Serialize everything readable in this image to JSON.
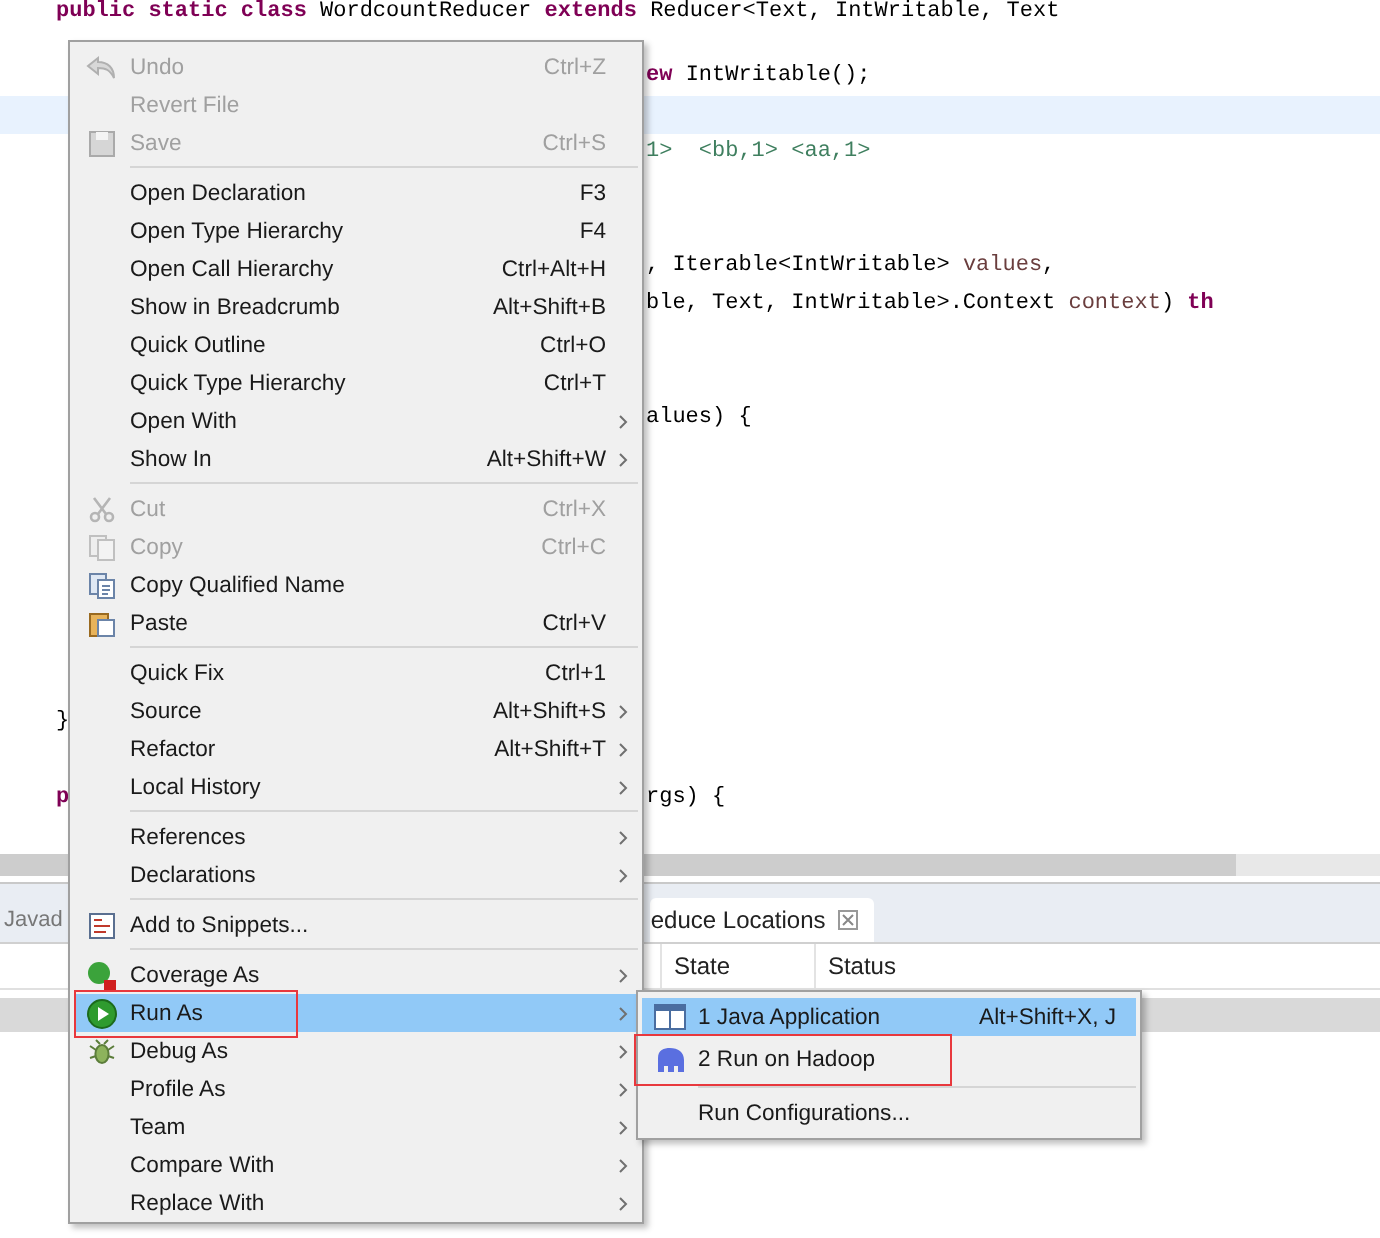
{
  "editor": {
    "lines": [
      {
        "left": [
          {
            "text": "public static class ",
            "kind": "keyword"
          },
          {
            "text": "WordcountReducer ",
            "kind": "plain"
          },
          {
            "text": "extends ",
            "kind": "keyword"
          },
          {
            "text": "Reducer<Text, IntWritable, Text",
            "kind": "plain"
          }
        ]
      },
      {
        "right": [
          {
            "text": "ew ",
            "kind": "keyword"
          },
          {
            "text": "IntWritable();",
            "kind": "plain"
          }
        ]
      },
      {
        "current": true
      },
      {
        "right": [
          {
            "text": "1>  <bb,1> <aa,1>",
            "kind": "comment"
          }
        ]
      },
      {
        "right": [
          {
            "text": ", Iterable<IntWritable> ",
            "kind": "plain"
          },
          {
            "text": "values",
            "kind": "param"
          },
          {
            "text": ",",
            "kind": "plain"
          }
        ]
      },
      {
        "right": [
          {
            "text": "ble, Text, IntWritable>.Context ",
            "kind": "plain"
          },
          {
            "text": "context",
            "kind": "param"
          },
          {
            "text": ") ",
            "kind": "plain"
          },
          {
            "text": "th",
            "kind": "keyword"
          }
        ]
      },
      {
        "right": [
          {
            "text": "alues) {",
            "kind": "plain"
          }
        ]
      },
      {
        "left": [
          {
            "text": "}",
            "kind": "plain"
          }
        ]
      },
      {
        "left": [
          {
            "text": "p",
            "kind": "keyword"
          }
        ],
        "right": [
          {
            "text": "rgs) {",
            "kind": "plain"
          }
        ]
      }
    ]
  },
  "bottom_panel": {
    "tabs": [
      {
        "label": "Javad",
        "selected": false,
        "closable": false
      },
      {
        "label": "educe Locations",
        "selected": true,
        "closable": true
      }
    ],
    "columns": [
      "State",
      "Status"
    ],
    "rows": [
      {
        "selected": true
      }
    ]
  },
  "context_menu": {
    "items": [
      {
        "kind": "item",
        "label": "Undo",
        "shortcut": "Ctrl+Z",
        "disabled": true,
        "submenu": false,
        "selected": false
      },
      {
        "kind": "item",
        "label": "Revert File",
        "disabled": true,
        "submenu": false,
        "selected": false
      },
      {
        "kind": "item",
        "label": "Save",
        "shortcut": "Ctrl+S",
        "disabled": true,
        "submenu": false,
        "selected": false
      },
      {
        "kind": "separator"
      },
      {
        "kind": "item",
        "label": "Open Declaration",
        "shortcut": "F3",
        "disabled": false,
        "submenu": false,
        "selected": false
      },
      {
        "kind": "item",
        "label": "Open Type Hierarchy",
        "shortcut": "F4",
        "disabled": false,
        "submenu": false,
        "selected": false
      },
      {
        "kind": "item",
        "label": "Open Call Hierarchy",
        "shortcut": "Ctrl+Alt+H",
        "disabled": false,
        "submenu": false,
        "selected": false
      },
      {
        "kind": "item",
        "label": "Show in Breadcrumb",
        "shortcut": "Alt+Shift+B",
        "disabled": false,
        "submenu": false,
        "selected": false
      },
      {
        "kind": "item",
        "label": "Quick Outline",
        "shortcut": "Ctrl+O",
        "disabled": false,
        "submenu": false,
        "selected": false
      },
      {
        "kind": "item",
        "label": "Quick Type Hierarchy",
        "shortcut": "Ctrl+T",
        "disabled": false,
        "submenu": false,
        "selected": false
      },
      {
        "kind": "item",
        "label": "Open With",
        "disabled": false,
        "submenu": true,
        "selected": false
      },
      {
        "kind": "item",
        "label": "Show In",
        "shortcut": "Alt+Shift+W",
        "disabled": false,
        "submenu": true,
        "selected": false
      },
      {
        "kind": "separator"
      },
      {
        "kind": "item",
        "label": "Cut",
        "shortcut": "Ctrl+X",
        "disabled": true,
        "submenu": false,
        "selected": false
      },
      {
        "kind": "item",
        "label": "Copy",
        "shortcut": "Ctrl+C",
        "disabled": true,
        "submenu": false,
        "selected": false
      },
      {
        "kind": "item",
        "label": "Copy Qualified Name",
        "disabled": false,
        "submenu": false,
        "selected": false
      },
      {
        "kind": "item",
        "label": "Paste",
        "shortcut": "Ctrl+V",
        "disabled": false,
        "submenu": false,
        "selected": false
      },
      {
        "kind": "separator"
      },
      {
        "kind": "item",
        "label": "Quick Fix",
        "shortcut": "Ctrl+1",
        "disabled": false,
        "submenu": false,
        "selected": false
      },
      {
        "kind": "item",
        "label": "Source",
        "shortcut": "Alt+Shift+S",
        "disabled": false,
        "submenu": true,
        "selected": false
      },
      {
        "kind": "item",
        "label": "Refactor",
        "shortcut": "Alt+Shift+T",
        "disabled": false,
        "submenu": true,
        "selected": false
      },
      {
        "kind": "item",
        "label": "Local History",
        "disabled": false,
        "submenu": true,
        "selected": false
      },
      {
        "kind": "separator"
      },
      {
        "kind": "item",
        "label": "References",
        "disabled": false,
        "submenu": true,
        "selected": false
      },
      {
        "kind": "item",
        "label": "Declarations",
        "disabled": false,
        "submenu": true,
        "selected": false
      },
      {
        "kind": "separator"
      },
      {
        "kind": "item",
        "label": "Add to Snippets...",
        "disabled": false,
        "submenu": false,
        "selected": false
      },
      {
        "kind": "separator"
      },
      {
        "kind": "item",
        "label": "Coverage As",
        "disabled": false,
        "submenu": true,
        "selected": false
      },
      {
        "kind": "item",
        "label": "Run As",
        "disabled": false,
        "submenu": true,
        "selected": true,
        "annotated": true
      },
      {
        "kind": "item",
        "label": "Debug As",
        "disabled": false,
        "submenu": true,
        "selected": false
      },
      {
        "kind": "item",
        "label": "Profile As",
        "disabled": false,
        "submenu": true,
        "selected": false
      },
      {
        "kind": "item",
        "label": "Team",
        "disabled": false,
        "submenu": true,
        "selected": false
      },
      {
        "kind": "item",
        "label": "Compare With",
        "disabled": false,
        "submenu": true,
        "selected": false
      },
      {
        "kind": "item",
        "label": "Replace With",
        "disabled": false,
        "submenu": true,
        "selected": false
      }
    ]
  },
  "submenu": {
    "items": [
      {
        "kind": "item",
        "label": "1 Java Application",
        "shortcut": "Alt+Shift+X, J",
        "selected": true,
        "annotated": false
      },
      {
        "kind": "item",
        "label": "2 Run on Hadoop",
        "selected": false,
        "annotated": true
      },
      {
        "kind": "separator"
      },
      {
        "kind": "item",
        "label": "Run Configurations...",
        "selected": false,
        "annotated": false
      }
    ]
  }
}
